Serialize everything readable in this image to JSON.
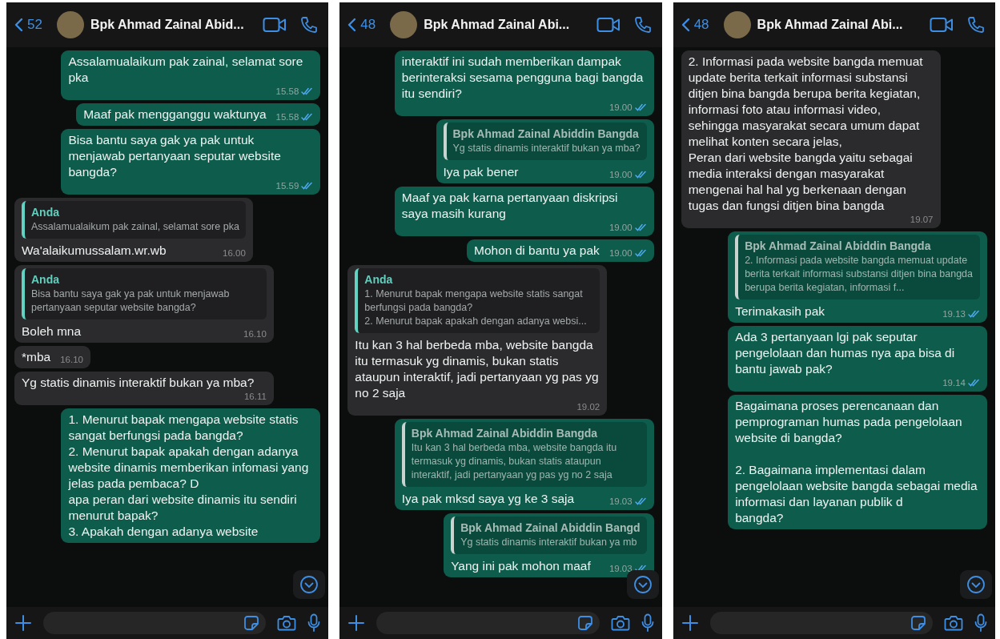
{
  "panels": [
    {
      "header": {
        "back_count": "52",
        "name": "Bpk Ahmad Zainal Abid..."
      },
      "messages": [
        {
          "kind": "out",
          "text": "Assalamualaikum pak zainal, selamat sore pka",
          "time": "15.58",
          "read": true
        },
        {
          "kind": "out",
          "text": "Maaf pak mengganggu waktunya",
          "time": "15.58",
          "read": true
        },
        {
          "kind": "out",
          "text": "Bisa bantu saya gak ya pak untuk menjawab pertanyaan seputar website bangda?",
          "time": "15.59",
          "read": true
        },
        {
          "kind": "in",
          "quote": {
            "author": "Anda",
            "text": "Assalamualaikum pak zainal, selamat sore pka"
          },
          "text": "Wa'alaikumussalam.wr.wb",
          "time": "16.00"
        },
        {
          "kind": "in",
          "quote": {
            "author": "Anda",
            "text": "Bisa bantu saya gak ya pak untuk menjawab pertanyaan seputar website bangda?"
          },
          "text": "Boleh mna",
          "time": "16.10"
        },
        {
          "kind": "in",
          "text": "*mba",
          "time": "16.10"
        },
        {
          "kind": "in",
          "text": "Yg statis dinamis interaktif bukan ya mba?",
          "time": "16.11"
        },
        {
          "kind": "out",
          "text": "1. Menurut bapak mengapa website statis sangat berfungsi pada bangda?\n2. Menurut bapak apakah dengan adanya website dinamis memberikan infomasi yang jelas pada pembaca? D\napa peran dari website dinamis itu sendiri menurut bapak?\n3. Apakah dengan adanya website"
        }
      ]
    },
    {
      "header": {
        "back_count": "48",
        "name": "Bpk Ahmad Zainal Abi..."
      },
      "messages": [
        {
          "kind": "out",
          "text": "interaktif ini sudah memberikan dampak berinteraksi sesama pengguna bagi bangda itu sendiri?",
          "time": "19.00",
          "read": true
        },
        {
          "kind": "out",
          "quote": {
            "author": "Bpk Ahmad Zainal Abiddin Bangda",
            "text": "Yg statis dinamis interaktif bukan ya mba?"
          },
          "text": "Iya pak bener",
          "time": "19.00",
          "read": true
        },
        {
          "kind": "out",
          "text": "Maaf ya pak karna pertanyaan diskripsi saya masih kurang",
          "time": "19.00",
          "read": true
        },
        {
          "kind": "out",
          "text": "Mohon di bantu ya pak",
          "time": "19.00",
          "read": true
        },
        {
          "kind": "in",
          "quote": {
            "author": "Anda",
            "text": "1. Menurut bapak mengapa website statis sangat berfungsi pada bangda?\n2. Menurut bapak apakah dengan adanya websi..."
          },
          "text": "Itu kan 3 hal berbeda mba, website bangda itu termasuk yg dinamis, bukan statis ataupun interaktif, jadi pertanyaan yg pas yg no 2 saja",
          "time": "19.02"
        },
        {
          "kind": "out",
          "quote": {
            "author": "Bpk Ahmad Zainal Abiddin Bangda",
            "text": "Itu kan 3 hal berbeda mba, website bangda itu termasuk yg dinamis, bukan statis ataupun interaktif, jadi pertanyaan yg pas yg no 2 saja"
          },
          "text": "Iya pak mksd saya yg ke 3 saja",
          "time": "19.03",
          "read": true
        },
        {
          "kind": "out",
          "quote": {
            "author": "Bpk Ahmad Zainal Abiddin Bangd",
            "text": "Yg statis dinamis interaktif bukan ya mb"
          },
          "text": "Yang ini pak mohon maaf",
          "time": "19.03",
          "read": true
        }
      ]
    },
    {
      "header": {
        "back_count": "48",
        "name": "Bpk Ahmad Zainal Abi..."
      },
      "messages": [
        {
          "kind": "in",
          "text": "2. Informasi pada website bangda memuat update berita terkait informasi substansi ditjen bina bangda berupa berita kegiatan, informasi foto atau informasi video, sehingga masyarakat secara umum dapat melihat konten secara jelas,\nPeran dari website bangda yaitu sebagai media interaksi dengan masyarakat mengenai hal hal yg berkenaan dengan tugas dan fungsi ditjen bina bangda",
          "time": "19.07"
        },
        {
          "kind": "out",
          "quote": {
            "author": "Bpk Ahmad Zainal Abiddin Bangda",
            "text": "2. Informasi pada website bangda memuat update berita terkait informasi substansi ditjen bina bangda berupa berita kegiatan, informasi f..."
          },
          "text": "Terimakasih pak",
          "time": "19.13",
          "read": true
        },
        {
          "kind": "out",
          "text": "Ada 3 pertanyaan lgi pak seputar pengelolaan dan humas nya apa bisa di bantu jawab pak?",
          "time": "19.14",
          "read": true
        },
        {
          "kind": "out",
          "text": "Bagaimana proses perencanaan dan pemprograman humas pada pengelolaan website di bangda?\n\n2. Bagaimana implementasi dalam pengelolaan website bangda sebagai media informasi dan layanan publik d\nbangda?"
        }
      ]
    }
  ]
}
